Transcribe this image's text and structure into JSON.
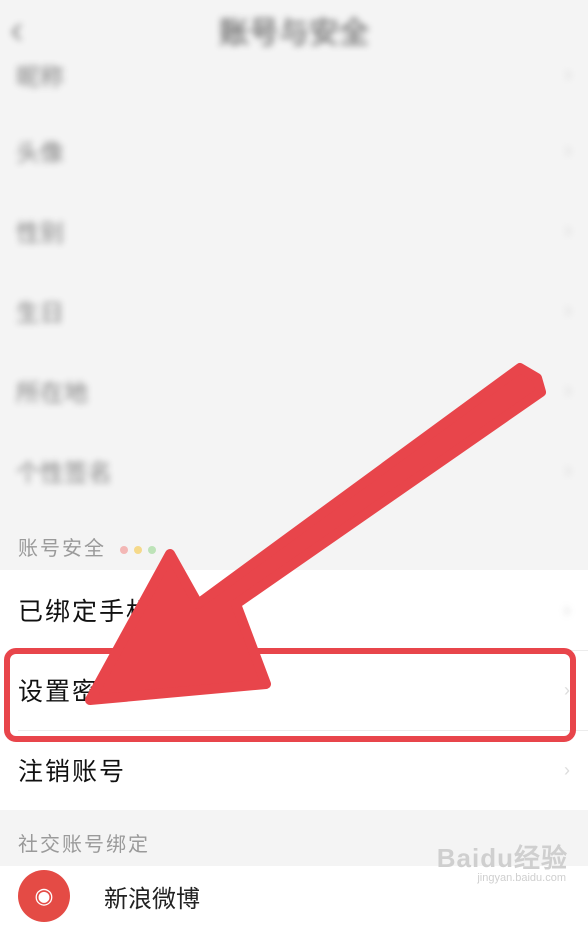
{
  "header": {
    "title": "账号与安全"
  },
  "blurred_rows": [
    {
      "label": "昵称",
      "value": "",
      "blue": false
    },
    {
      "label": "头像",
      "value": "",
      "blue": true
    },
    {
      "label": "性别",
      "value": "",
      "blue": false
    },
    {
      "label": "生日",
      "value": "",
      "blue": false
    },
    {
      "label": "所在地",
      "value": "",
      "blue": true
    },
    {
      "label": "个性签名",
      "value": "",
      "blue": true
    }
  ],
  "account_security": {
    "section_label": "账号安全",
    "dot_colors": [
      "#f3b7b5",
      "#f5d98a",
      "#bde3b8"
    ],
    "rows": [
      {
        "label": "已绑定手机号",
        "value": ""
      },
      {
        "label": "设置密码",
        "value": ""
      },
      {
        "label": "注销账号",
        "value": ""
      }
    ]
  },
  "social": {
    "section_label": "社交账号绑定",
    "items": [
      {
        "label": "新浪微博",
        "icon": "weibo-icon"
      }
    ]
  },
  "annotation": {
    "highlight_color": "#e8454b"
  },
  "watermark": {
    "text": "Baidu经验",
    "sub": "jingyan.baidu.com"
  }
}
